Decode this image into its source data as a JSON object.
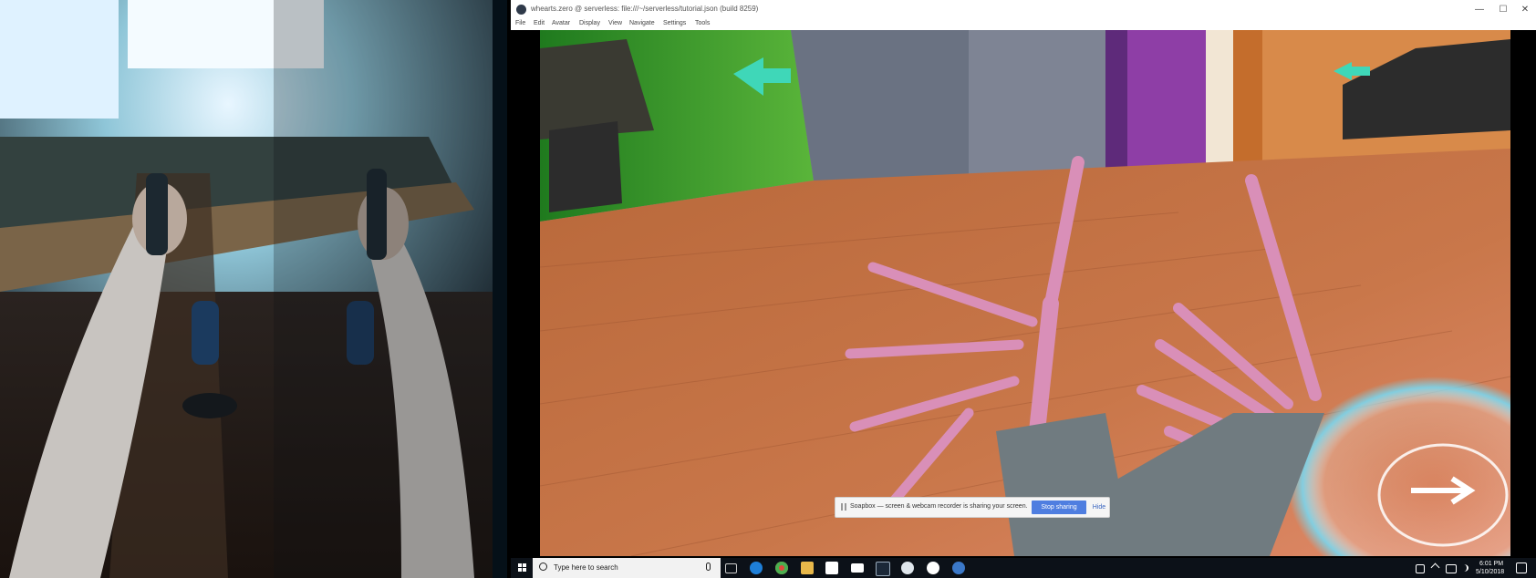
{
  "window": {
    "title": "whearts.zero @ serverless: file:///~/serverless/tutorial.json (build 8259)",
    "controls": {
      "minimize": "—",
      "maximize": "☐",
      "close": "✕"
    }
  },
  "menu": [
    {
      "label": "File"
    },
    {
      "label": "Edit"
    },
    {
      "label": "Avatar"
    },
    {
      "label": "Display"
    },
    {
      "label": "View"
    },
    {
      "label": "Navigate"
    },
    {
      "label": "Settings"
    },
    {
      "label": "Tools"
    }
  ],
  "share_banner": {
    "message": "Soapbox — screen & webcam recorder is sharing your screen.",
    "stop_label": "Stop sharing",
    "hide_label": "Hide"
  },
  "taskbar": {
    "search_placeholder": "Type here to search",
    "pinned_icons": [
      "task-view-icon",
      "edge-icon",
      "chrome-icon",
      "file-explorer-icon",
      "store-icon",
      "mail-icon",
      "steam-icon",
      "vr-app-icon",
      "interface-app-icon",
      "settings-app-icon"
    ],
    "clock_time": "6:01 PM",
    "clock_date": "5/10/2018"
  },
  "colors": {
    "window_bg": "#ffffff",
    "stop_button": "#4f7ee0",
    "taskbar": "#0c1118",
    "search_bg": "#f2f2f2",
    "skeleton_hand": "#d98fb8",
    "floor": "#c8703e",
    "green_wall": "#3f9a2c",
    "purple_pillar": "#8e3ea6",
    "teleport_ring": "#7ad6ee"
  }
}
